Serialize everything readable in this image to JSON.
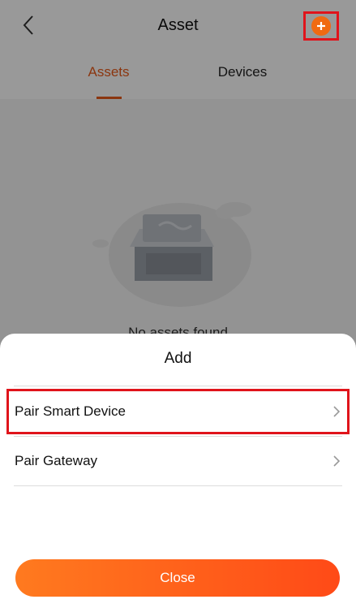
{
  "header": {
    "title": "Asset",
    "back_icon": "chevron-left-icon",
    "add_icon": "plus-circle-icon"
  },
  "tabs": [
    {
      "label": "Assets",
      "active": true
    },
    {
      "label": "Devices",
      "active": false
    }
  ],
  "empty_state": {
    "icon": "empty-box-icon",
    "text": "No assets found"
  },
  "sheet": {
    "title": "Add",
    "options": [
      {
        "label": "Pair Smart Device",
        "icon": "chevron-right-icon",
        "highlighted": true
      },
      {
        "label": "Pair Gateway",
        "icon": "chevron-right-icon",
        "highlighted": false
      }
    ],
    "close_label": "Close"
  },
  "colors": {
    "accent": "#e85a1a",
    "add_button": "#f06a12",
    "highlight_frame": "#e0141b",
    "close_gradient_start": "#ff7a1f",
    "close_gradient_end": "#ff4a17"
  }
}
